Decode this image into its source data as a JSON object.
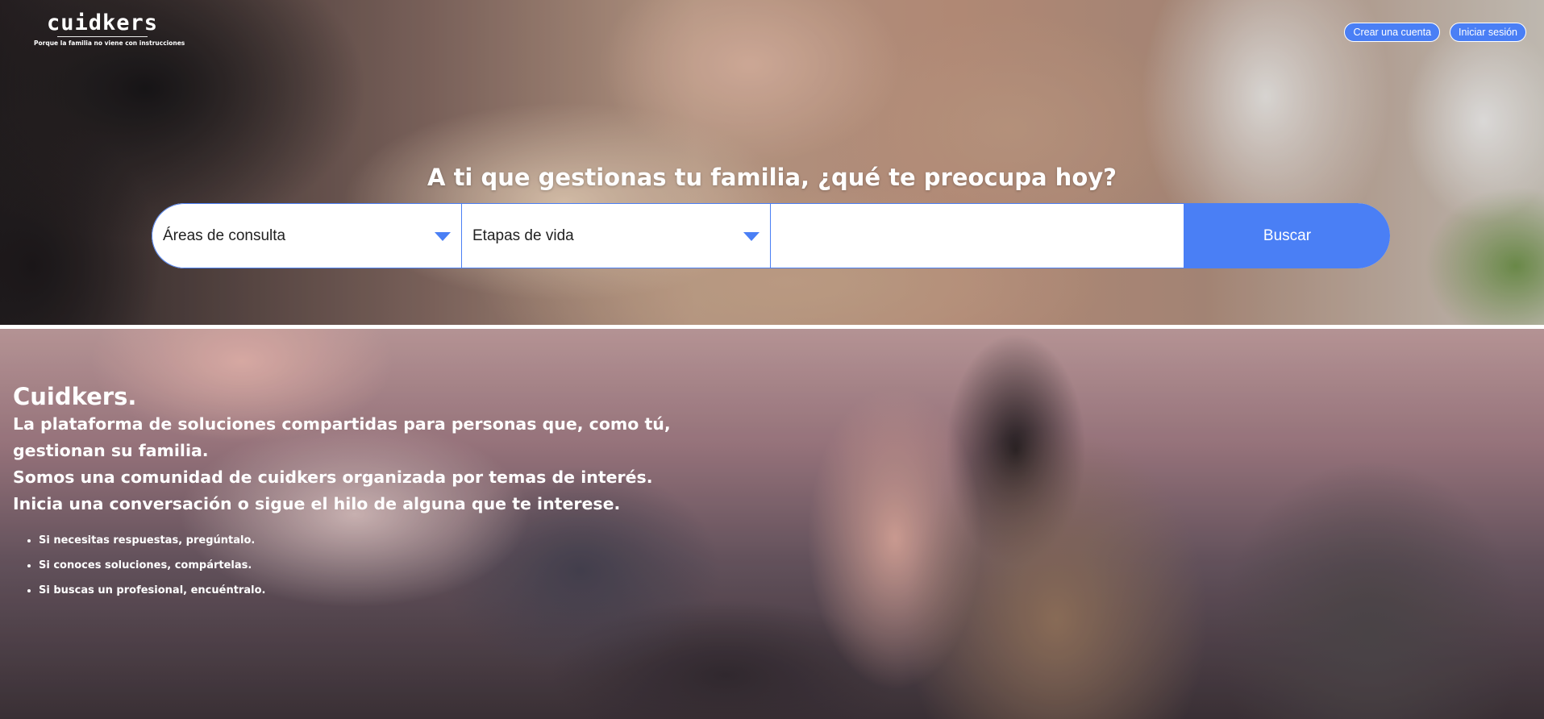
{
  "header": {
    "brand_name": "cuidkers",
    "brand_tagline": "Porque la familia no viene con instrucciones",
    "create_account_label": "Crear una cuenta",
    "login_label": "Iniciar sesión"
  },
  "hero": {
    "title": "A ti que gestionas tu familia, ¿qué te preocupa hoy?",
    "search": {
      "areas_select_value": "Áreas de consulta",
      "stages_select_value": "Etapas de vida",
      "query_value": "",
      "query_placeholder": "",
      "button_label": "Buscar"
    }
  },
  "intro": {
    "heading": "Cuidkers.",
    "lines": [
      "La plataforma de soluciones compartidas para personas que, como tú,",
      "gestionan su familia.",
      "Somos una comunidad de cuidkers organizada por temas de interés.",
      "Inicia una conversación o sigue el hilo de alguna que te interese."
    ],
    "bullets": [
      "Si necesitas respuestas, pregúntalo.",
      "Si conoces soluciones, compártelas.",
      "Si buscas un profesional, encuéntralo."
    ]
  },
  "colors": {
    "accent": "#4a7ff5",
    "text_on_image": "#ffffff"
  },
  "icons": {
    "select_caret": "chevron-down-icon"
  }
}
